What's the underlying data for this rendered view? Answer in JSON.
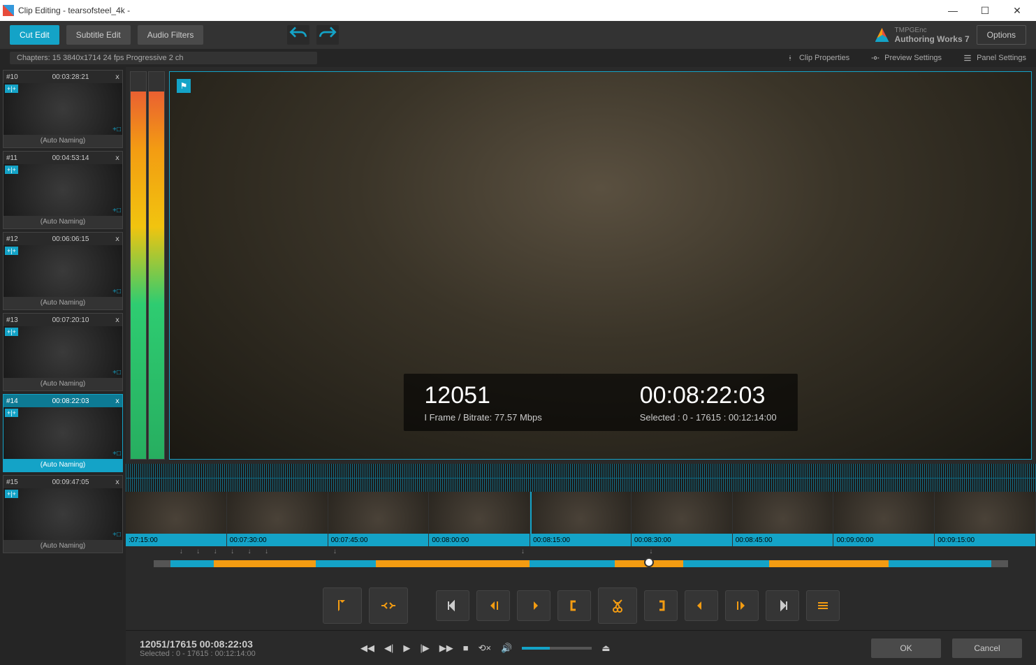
{
  "window": {
    "title": "Clip Editing - tearsofsteel_4k -"
  },
  "toolbar": {
    "cut_edit": "Cut Edit",
    "subtitle_edit": "Subtitle Edit",
    "audio_filters": "Audio Filters",
    "options": "Options",
    "brand1": "TMPGEnc",
    "brand2": "Authoring Works 7"
  },
  "infobar": {
    "chapters": "Chapters: 15  3840x1714 24 fps Progressive  2 ch",
    "clip_props": "Clip Properties",
    "preview_settings": "Preview Settings",
    "panel_settings": "Panel Settings"
  },
  "chapters": [
    {
      "num": "#10",
      "tc": "00:03:28:21",
      "name": "(Auto Naming)",
      "active": false
    },
    {
      "num": "#11",
      "tc": "00:04:53:14",
      "name": "(Auto Naming)",
      "active": false
    },
    {
      "num": "#12",
      "tc": "00:06:06:15",
      "name": "(Auto Naming)",
      "active": false
    },
    {
      "num": "#13",
      "tc": "00:07:20:10",
      "name": "(Auto Naming)",
      "active": false
    },
    {
      "num": "#14",
      "tc": "00:08:22:03",
      "name": "(Auto Naming)",
      "active": true
    },
    {
      "num": "#15",
      "tc": "00:09:47:05",
      "name": "(Auto Naming)",
      "active": false
    }
  ],
  "overlay": {
    "frame": "12051",
    "frame_info": "I Frame    / Bitrate: 77.57 Mbps",
    "timecode": "00:08:22:03",
    "selected": "Selected : 0 - 17615 : 00:12:14:00"
  },
  "filmstrip": [
    {
      "t": ":07:15:00",
      "mark": false
    },
    {
      "t": "00:07:30:00",
      "mark": false
    },
    {
      "t": "00:07:45:00",
      "mark": false
    },
    {
      "t": "00:08:00:00",
      "mark": false
    },
    {
      "t": "00:08:15:00",
      "mark": true
    },
    {
      "t": "00:08:30:00",
      "mark": false
    },
    {
      "t": "00:08:45:00",
      "mark": false
    },
    {
      "t": "00:09:00:00",
      "mark": false
    },
    {
      "t": "00:09:15:00",
      "mark": false
    }
  ],
  "track_segments": [
    {
      "l": 2,
      "w": 5,
      "c": "#14a3c7"
    },
    {
      "l": 7,
      "w": 12,
      "c": "#f39c12"
    },
    {
      "l": 19,
      "w": 7,
      "c": "#14a3c7"
    },
    {
      "l": 26,
      "w": 18,
      "c": "#f39c12"
    },
    {
      "l": 44,
      "w": 10,
      "c": "#14a3c7"
    },
    {
      "l": 54,
      "w": 8,
      "c": "#f39c12"
    },
    {
      "l": 62,
      "w": 10,
      "c": "#14a3c7"
    },
    {
      "l": 72,
      "w": 14,
      "c": "#f39c12"
    },
    {
      "l": 86,
      "w": 12,
      "c": "#14a3c7"
    }
  ],
  "track_playhead_pct": 58,
  "arrows_pct": [
    3,
    5,
    7,
    9,
    11,
    13,
    21,
    43,
    58
  ],
  "bottom": {
    "pos": "12051/17615  00:08:22:03",
    "sel": "Selected : 0 - 17615 : 00:12:14:00",
    "ok": "OK",
    "cancel": "Cancel"
  }
}
